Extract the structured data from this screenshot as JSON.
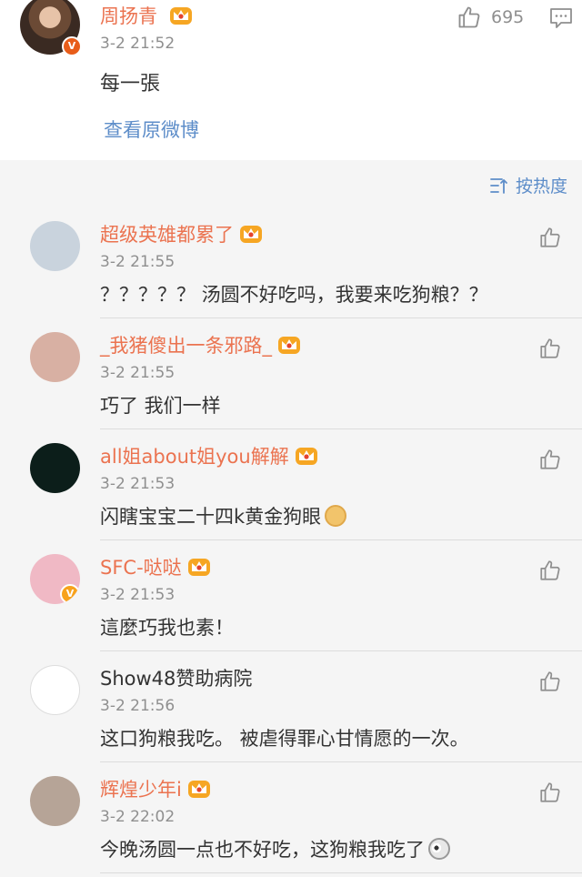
{
  "post": {
    "username": "周扬青",
    "time": "3-2 21:52",
    "text": "每一張",
    "link": "查看原微博",
    "likes": "695"
  },
  "sort": {
    "label": "按热度"
  },
  "comments": [
    {
      "username": "超级英雄都累了",
      "time": "3-2 21:55",
      "text": "？？？？？ 汤圆不好吃吗，我要来吃狗粮？？",
      "vip": true,
      "verified": false,
      "avatar_color": "#c9d3dd"
    },
    {
      "username": "_我猪傻出一条邪路_",
      "time": "3-2 21:55",
      "text": "巧了 我们一样",
      "vip": true,
      "verified": false,
      "avatar_color": "#d8b0a3"
    },
    {
      "username": "all姐about姐you解解",
      "time": "3-2 21:53",
      "text": "闪瞎宝宝二十四k黄金狗眼",
      "vip": true,
      "verified": false,
      "avatar_color": "#0c1e1a"
    },
    {
      "username": "SFC-哒哒",
      "time": "3-2 21:53",
      "text": "這麼巧我也素！",
      "vip": true,
      "verified": true,
      "avatar_color": "#f0b9c5"
    },
    {
      "username": "Show48赞助病院",
      "time": "3-2 21:56",
      "text": "这口狗粮我吃。 被虐得罪心甘情愿的一次。",
      "vip": false,
      "verified": false,
      "avatar_color": "#ffffff"
    },
    {
      "username": "辉煌少年i",
      "time": "3-2 22:02",
      "text": "今晚汤圆一点也不好吃，这狗粮我吃了",
      "vip": true,
      "verified": false,
      "avatar_color": "#b6a497"
    }
  ],
  "colors": {
    "username_vip": "#eb7350",
    "link": "#5d8dc9",
    "meta": "#8f8f8f"
  }
}
